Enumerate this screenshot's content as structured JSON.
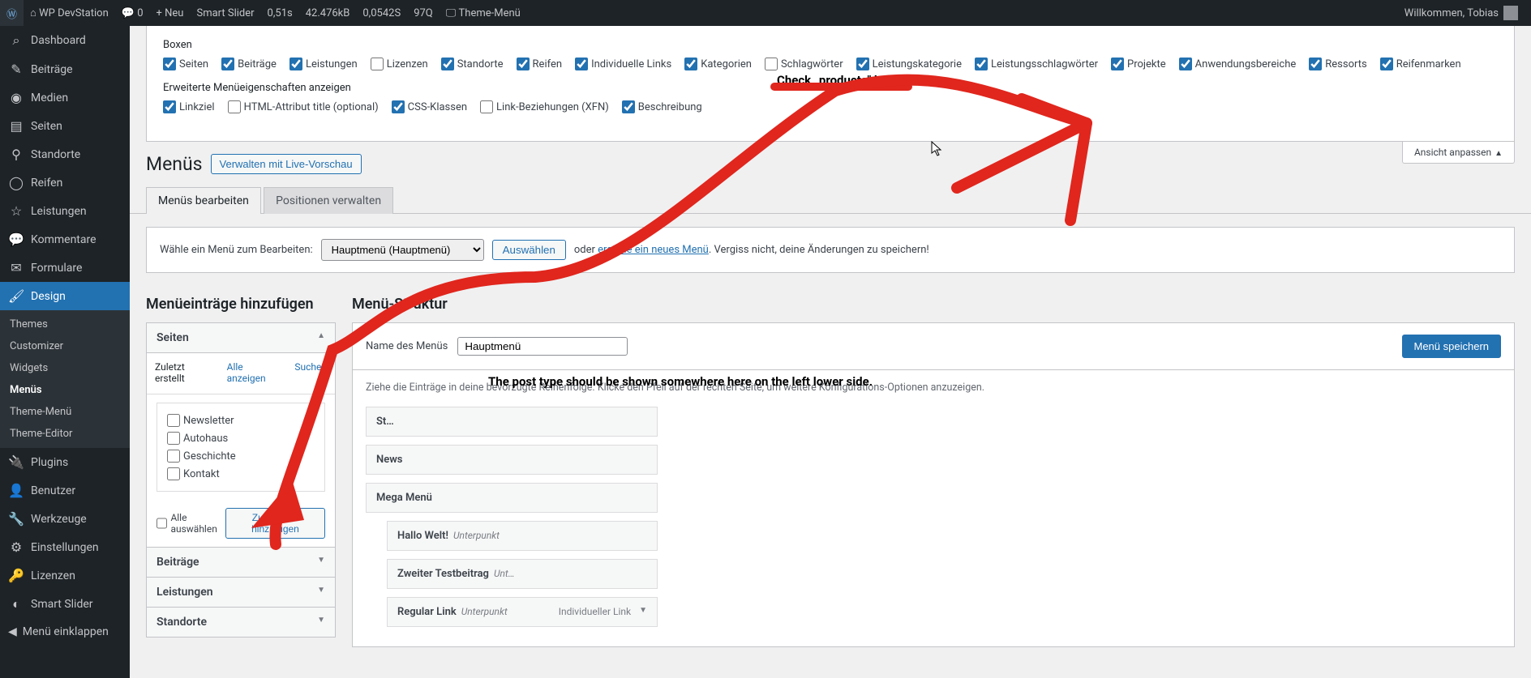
{
  "adminbar": {
    "site": "WP DevStation",
    "comments": "0",
    "new": "Neu",
    "smartslider": "Smart Slider",
    "perf1": "0,51s",
    "perf2": "42.476kB",
    "perf3": "0,0542S",
    "perf4": "97Q",
    "thememenu": "Theme-Menü",
    "welcome": "Willkommen, Tobias"
  },
  "sidebar": {
    "items": [
      {
        "icon": "⌕",
        "label": "Dashboard"
      },
      {
        "icon": "✎",
        "label": "Beiträge"
      },
      {
        "icon": "◉",
        "label": "Medien"
      },
      {
        "icon": "▤",
        "label": "Seiten"
      },
      {
        "icon": "⚲",
        "label": "Standorte"
      },
      {
        "icon": "◯",
        "label": "Reifen"
      },
      {
        "icon": "☆",
        "label": "Leistungen"
      },
      {
        "icon": "💬",
        "label": "Kommentare"
      },
      {
        "icon": "✉",
        "label": "Formulare"
      },
      {
        "icon": "🖌",
        "label": "Design"
      }
    ],
    "design_sub": [
      {
        "label": "Themes"
      },
      {
        "label": "Customizer"
      },
      {
        "label": "Widgets"
      },
      {
        "label": "Menüs",
        "current": true
      },
      {
        "label": "Theme-Menü"
      },
      {
        "label": "Theme-Editor"
      }
    ],
    "items2": [
      {
        "icon": "🔌",
        "label": "Plugins"
      },
      {
        "icon": "👤",
        "label": "Benutzer"
      },
      {
        "icon": "🔧",
        "label": "Werkzeuge"
      },
      {
        "icon": "⚙",
        "label": "Einstellungen"
      },
      {
        "icon": "🔑",
        "label": "Lizenzen"
      },
      {
        "icon": "◐",
        "label": "Smart Slider"
      }
    ],
    "collapse": "Menü einklappen"
  },
  "screen_options": {
    "boxes_label": "Boxen",
    "boxes": [
      {
        "label": "Seiten",
        "checked": true
      },
      {
        "label": "Beiträge",
        "checked": true
      },
      {
        "label": "Leistungen",
        "checked": true
      },
      {
        "label": "Lizenzen",
        "checked": false
      },
      {
        "label": "Standorte",
        "checked": true
      },
      {
        "label": "Reifen",
        "checked": true
      },
      {
        "label": "Individuelle Links",
        "checked": true
      },
      {
        "label": "Kategorien",
        "checked": true
      },
      {
        "label": "Schlagwörter",
        "checked": false
      },
      {
        "label": "Leistungskategorie",
        "checked": true
      },
      {
        "label": "Leistungsschlagwörter",
        "checked": true
      },
      {
        "label": "Projekte",
        "checked": true
      },
      {
        "label": "Anwendungsbereiche",
        "checked": true
      },
      {
        "label": "Ressorts",
        "checked": true
      },
      {
        "label": "Reifenmarken",
        "checked": true
      }
    ],
    "advanced_label": "Erweiterte Menüeigenschaften anzeigen",
    "advanced": [
      {
        "label": "Linkziel",
        "checked": true
      },
      {
        "label": "HTML-Attribut title (optional)",
        "checked": false
      },
      {
        "label": "CSS-Klassen",
        "checked": true
      },
      {
        "label": "Link-Beziehungen (XFN)",
        "checked": false
      },
      {
        "label": "Beschreibung",
        "checked": true
      }
    ],
    "tab": "Ansicht anpassen"
  },
  "page": {
    "title": "Menüs",
    "live_preview": "Verwalten mit Live-Vorschau"
  },
  "tabs": {
    "edit": "Menüs bearbeiten",
    "positions": "Positionen verwalten"
  },
  "select_row": {
    "label": "Wähle ein Menü zum Bearbeiten:",
    "selected": "Hauptmenü (Hauptmenü)",
    "button": "Auswählen",
    "or": "oder",
    "link": "erstelle ein neues Menü",
    "suffix": ". Vergiss nicht, deine Änderungen zu speichern!"
  },
  "left_col": {
    "heading": "Menüeinträge hinzufügen",
    "pages_head": "Seiten",
    "tabs": {
      "recent": "Zuletzt erstellt",
      "all": "Alle anzeigen",
      "search": "Suchen"
    },
    "pages": [
      {
        "label": "Newsletter"
      },
      {
        "label": "Autohaus"
      },
      {
        "label": "Geschichte"
      },
      {
        "label": "Kontakt"
      }
    ],
    "select_all": "Alle auswählen",
    "add_btn": "Zum Menü hinzufügen",
    "acc2": "Beiträge",
    "acc3": "Leistungen",
    "acc4": "Standorte"
  },
  "right_col": {
    "heading": "Menü-Struktur",
    "name_label": "Name des Menüs",
    "name_value": "Hauptmenü",
    "save": "Menü speichern",
    "desc": "Ziehe die Einträge in deine bevorzugte Reihenfolge. Klicke den Pfeil auf der rechten Seite, um weitere Konfigurations-Optionen anzuzeigen.",
    "items": [
      {
        "title": "St…",
        "sub": "",
        "type": "",
        "depth": 0
      },
      {
        "title": "News",
        "sub": "",
        "type": "",
        "depth": 0
      },
      {
        "title": "Mega Menü",
        "sub": "",
        "type": "",
        "depth": 0
      },
      {
        "title": "Hallo Welt!",
        "sub": "Unterpunkt",
        "type": "",
        "depth": 1
      },
      {
        "title": "Zweiter Testbeitrag",
        "sub": "Unt…",
        "type": "",
        "depth": 1
      },
      {
        "title": "Regular Link",
        "sub": "Unterpunkt",
        "type": "Individueller Link",
        "depth": 1
      }
    ]
  },
  "annotations": {
    "a1": "Check „products\" here",
    "a2": "The post type should be shown somewhere here on the left lower side."
  }
}
